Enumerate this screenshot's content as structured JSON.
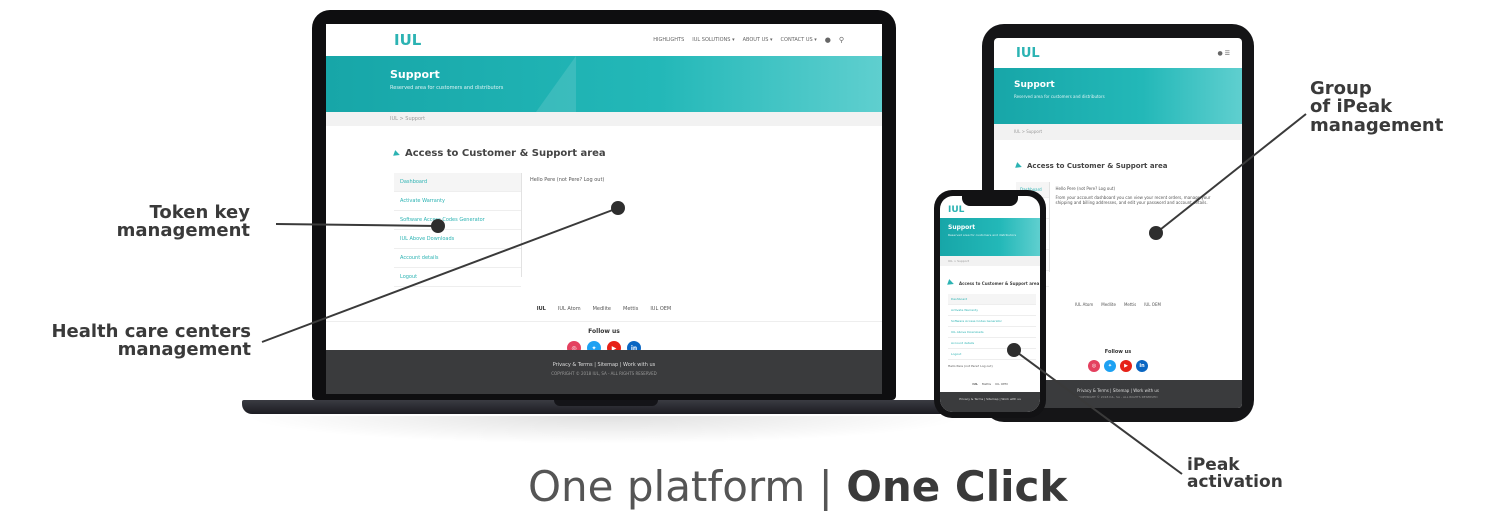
{
  "site": {
    "logo": "IUL",
    "nav": [
      "HIGHLIGHTS",
      "IUL SOLUTIONS ▾",
      "ABOUT US ▾",
      "CONTACT US ▾"
    ],
    "hero_title": "Support",
    "hero_subtitle": "Reserved area for customers and distributors",
    "breadcrumb": "IUL > Support",
    "section_title": "Access to Customer & Support area",
    "menu": [
      "Dashboard",
      "Activate Warranty",
      "Software Access Codes Generator",
      "IUL Above Downloads",
      "Account details",
      "Logout"
    ],
    "greeting": "Hello Pere (not Pere? Log out)",
    "tablet_content": "From your account dashboard you can view your recent orders, manage your shipping and billing addresses, and edit your password and account details.",
    "brands": [
      "IUL",
      "IUL Atom",
      "Medlite",
      "Mettis",
      "IUL OEM"
    ],
    "follow_us": "Follow us",
    "social": [
      {
        "name": "instagram",
        "glyph": "◎"
      },
      {
        "name": "twitter",
        "glyph": "✦"
      },
      {
        "name": "youtube",
        "glyph": "▶"
      },
      {
        "name": "linkedin",
        "glyph": "in"
      }
    ],
    "footer_links": "Privacy & Terms | Sitemap | Work with us",
    "copyright": "COPYRIGHT © 2018 IUL, SA - ALL RIGHTS RESERVED",
    "accent_color": "#2cb3b3"
  },
  "callouts": {
    "token": [
      "Token key",
      "management"
    ],
    "health": [
      "Health care centers",
      "management"
    ],
    "group": [
      "Group",
      "of iPeak",
      "management"
    ],
    "ipeak": [
      "iPeak",
      "activation"
    ]
  },
  "tagline": {
    "light": "One platform | ",
    "bold": "One Click"
  }
}
